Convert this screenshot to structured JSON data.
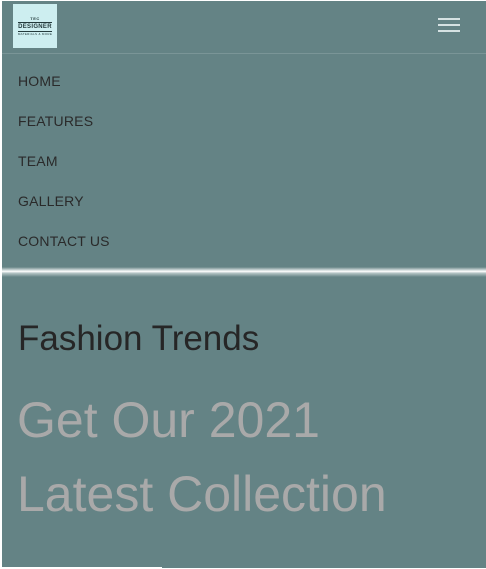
{
  "header": {
    "logo": {
      "line1": "TEC",
      "line2": "DESIGNER",
      "line3": "MATERIALS & MORE"
    },
    "menu_icon": "hamburger-icon"
  },
  "nav": {
    "items": [
      {
        "label": "HOME"
      },
      {
        "label": "FEATURES"
      },
      {
        "label": "TEAM"
      },
      {
        "label": "GALLERY"
      },
      {
        "label": "CONTACT US"
      }
    ]
  },
  "hero": {
    "subtitle": "Fashion Trends",
    "title_line1": "Get Our 2021",
    "title_line2": "Latest Collection"
  },
  "colors": {
    "background": "#648385",
    "logo_bg": "#cdeef0",
    "nav_text": "#2a2a2a",
    "hero_title": "#a9a9a9"
  }
}
